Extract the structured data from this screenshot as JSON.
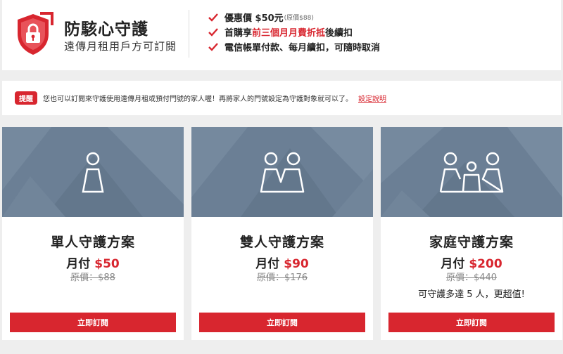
{
  "header": {
    "title": "防駭心守護",
    "subtitle": "遠傳月租用戶方可訂閱",
    "benefits": [
      {
        "prefix": "優惠價 $50元",
        "note": "(原價$88)",
        "highlight": "",
        "suffix": ""
      },
      {
        "prefix": "首購享",
        "note": "",
        "highlight": "前三個月月費折抵",
        "suffix": "後續扣"
      },
      {
        "prefix": "電信帳單付款、每月續扣，可隨時取消",
        "note": "",
        "highlight": "",
        "suffix": ""
      }
    ]
  },
  "tip": {
    "badge": "提醒",
    "text": "您也可以訂閱來守護使用遠傳月租或預付門號的家人喔！再將家人的門號設定為守護對象就可以了。",
    "link": "設定說明"
  },
  "plans": [
    {
      "name": "單人守護方案",
      "price_prefix": "月付",
      "price": "$50",
      "original": "原價：$88",
      "extra": "",
      "button": "立即訂閱"
    },
    {
      "name": "雙人守護方案",
      "price_prefix": "月付",
      "price": "$90",
      "original": "原價：$176",
      "extra": "",
      "button": "立即訂閱"
    },
    {
      "name": "家庭守護方案",
      "price_prefix": "月付",
      "price": "$200",
      "original": "原價：$440",
      "extra": "可守護多達 5 人，更超值!",
      "button": "立即訂閱"
    }
  ],
  "colors": {
    "accent": "#d8262f",
    "hero": "#6b7f95",
    "background": "#eeeeee"
  },
  "icons": {
    "logo": "shield-lock-icon",
    "check": "check-icon",
    "single": "person-icon",
    "couple": "two-people-icon",
    "family": "family-icon"
  }
}
